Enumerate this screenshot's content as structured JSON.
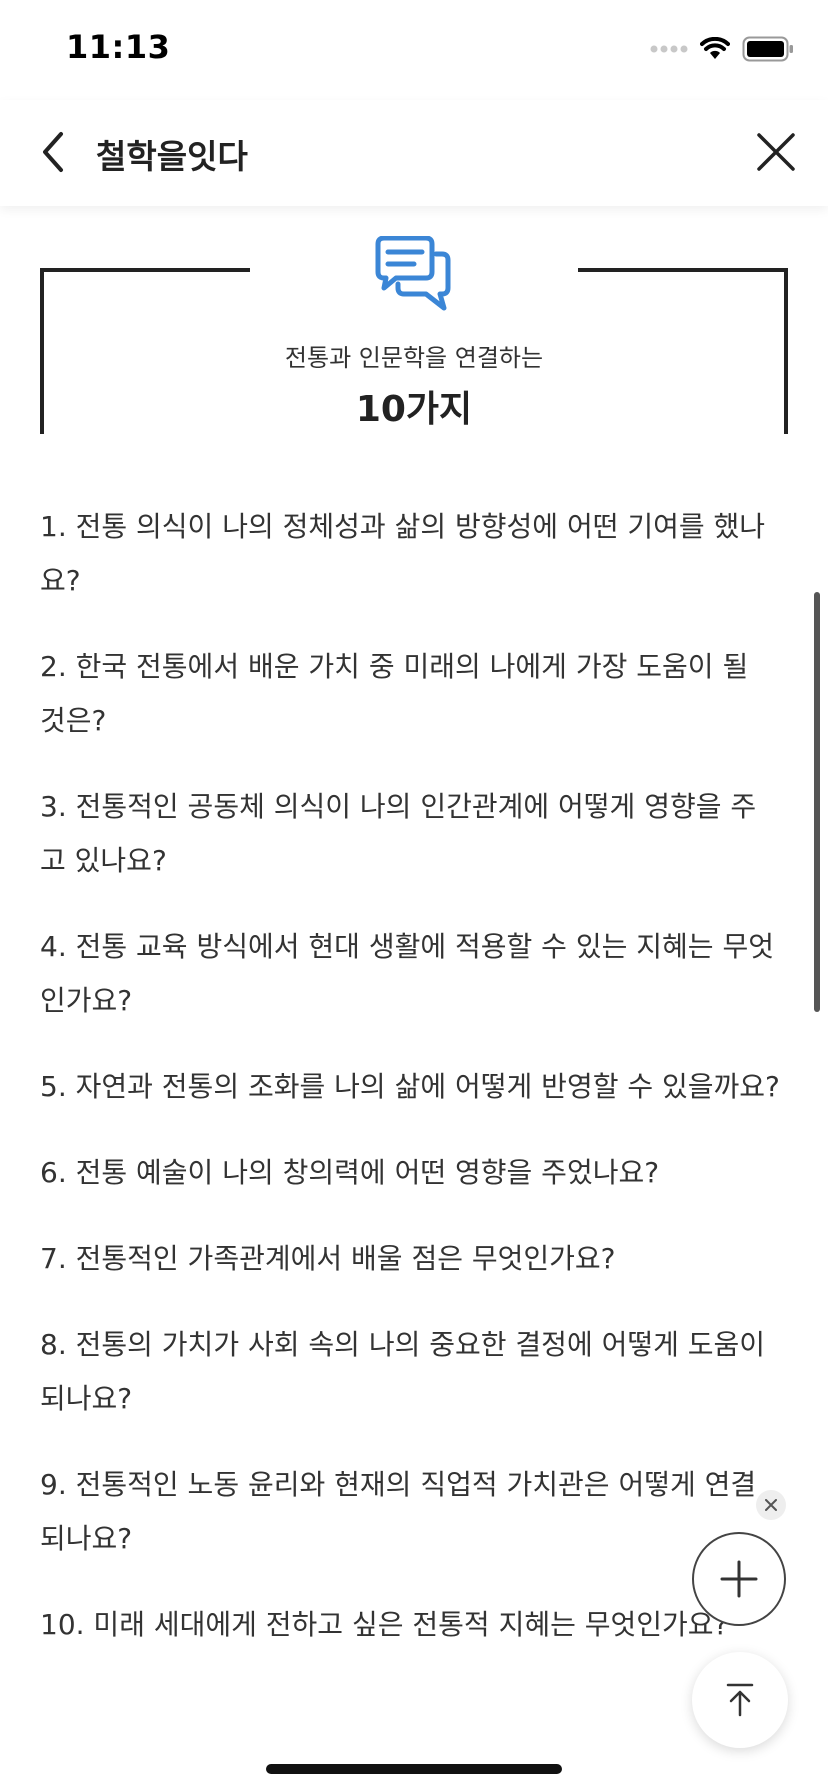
{
  "status_bar": {
    "time": "11:13"
  },
  "nav": {
    "title": "철학을잇다",
    "back_icon": "chevron-left-icon",
    "close_icon": "close-icon"
  },
  "header": {
    "icon": "chat-bubbles-icon",
    "icon_color": "#3b86d6",
    "subtitle": "전통과 인문학을 연결하는",
    "title": "10가지"
  },
  "questions": [
    "1. 전통 의식이 나의 정체성과 삶의 방향성에 어떤 기여를 했나요?",
    "2. 한국 전통에서 배운 가치 중 미래의 나에게 가장 도움이 될 것은?",
    "3. 전통적인 공동체 의식이 나의 인간관계에 어떻게 영향을 주고 있나요?",
    "4. 전통 교육 방식에서 현대 생활에 적용할 수 있는 지혜는 무엇인가요?",
    "5. 자연과 전통의 조화를 나의 삶에 어떻게 반영할 수 있을까요?",
    "6. 전통 예술이 나의 창의력에 어떤 영향을 주었나요?",
    "7. 전통적인 가족관계에서 배울 점은 무엇인가요?",
    "8. 전통의 가치가 사회 속의 나의 중요한 결정에 어떻게 도움이 되나요?",
    "9. 전통적인 노동 윤리와 현재의 직업적 가치관은 어떻게 연결되나요?",
    "10. 미래 세대에게 전하고 싶은 전통적 지혜는 무엇인가요?"
  ],
  "floating": {
    "dismiss_icon": "small-close-icon",
    "add_icon": "plus-icon",
    "top_icon": "arrow-up-to-top-icon"
  }
}
